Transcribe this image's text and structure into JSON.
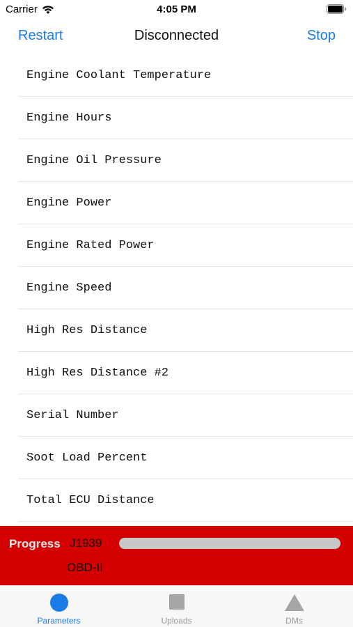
{
  "status_bar": {
    "carrier": "Carrier",
    "time": "4:05 PM"
  },
  "nav": {
    "left_button": "Restart",
    "title": "Disconnected",
    "right_button": "Stop"
  },
  "parameters": [
    "Engine Coolant Temperature",
    "Engine Hours",
    "Engine Oil Pressure",
    "Engine Power",
    "Engine Rated Power",
    "Engine Speed",
    "High Res Distance",
    "High Res Distance #2",
    "Serial Number",
    "Soot Load Percent",
    "Total ECU Distance"
  ],
  "progress": {
    "label": "Progress",
    "protocol_1": "J1939",
    "protocol_2": "OBD-II",
    "value": 1.0,
    "panel_color": "#d50000"
  },
  "tabs": [
    {
      "label": "Parameters",
      "icon": "circle-icon",
      "active": true
    },
    {
      "label": "Uploads",
      "icon": "square-icon",
      "active": false
    },
    {
      "label": "DMs",
      "icon": "triangle-icon",
      "active": false
    }
  ],
  "colors": {
    "accent": "#1a7ae6",
    "inactive_icon": "#a5a5a5"
  }
}
